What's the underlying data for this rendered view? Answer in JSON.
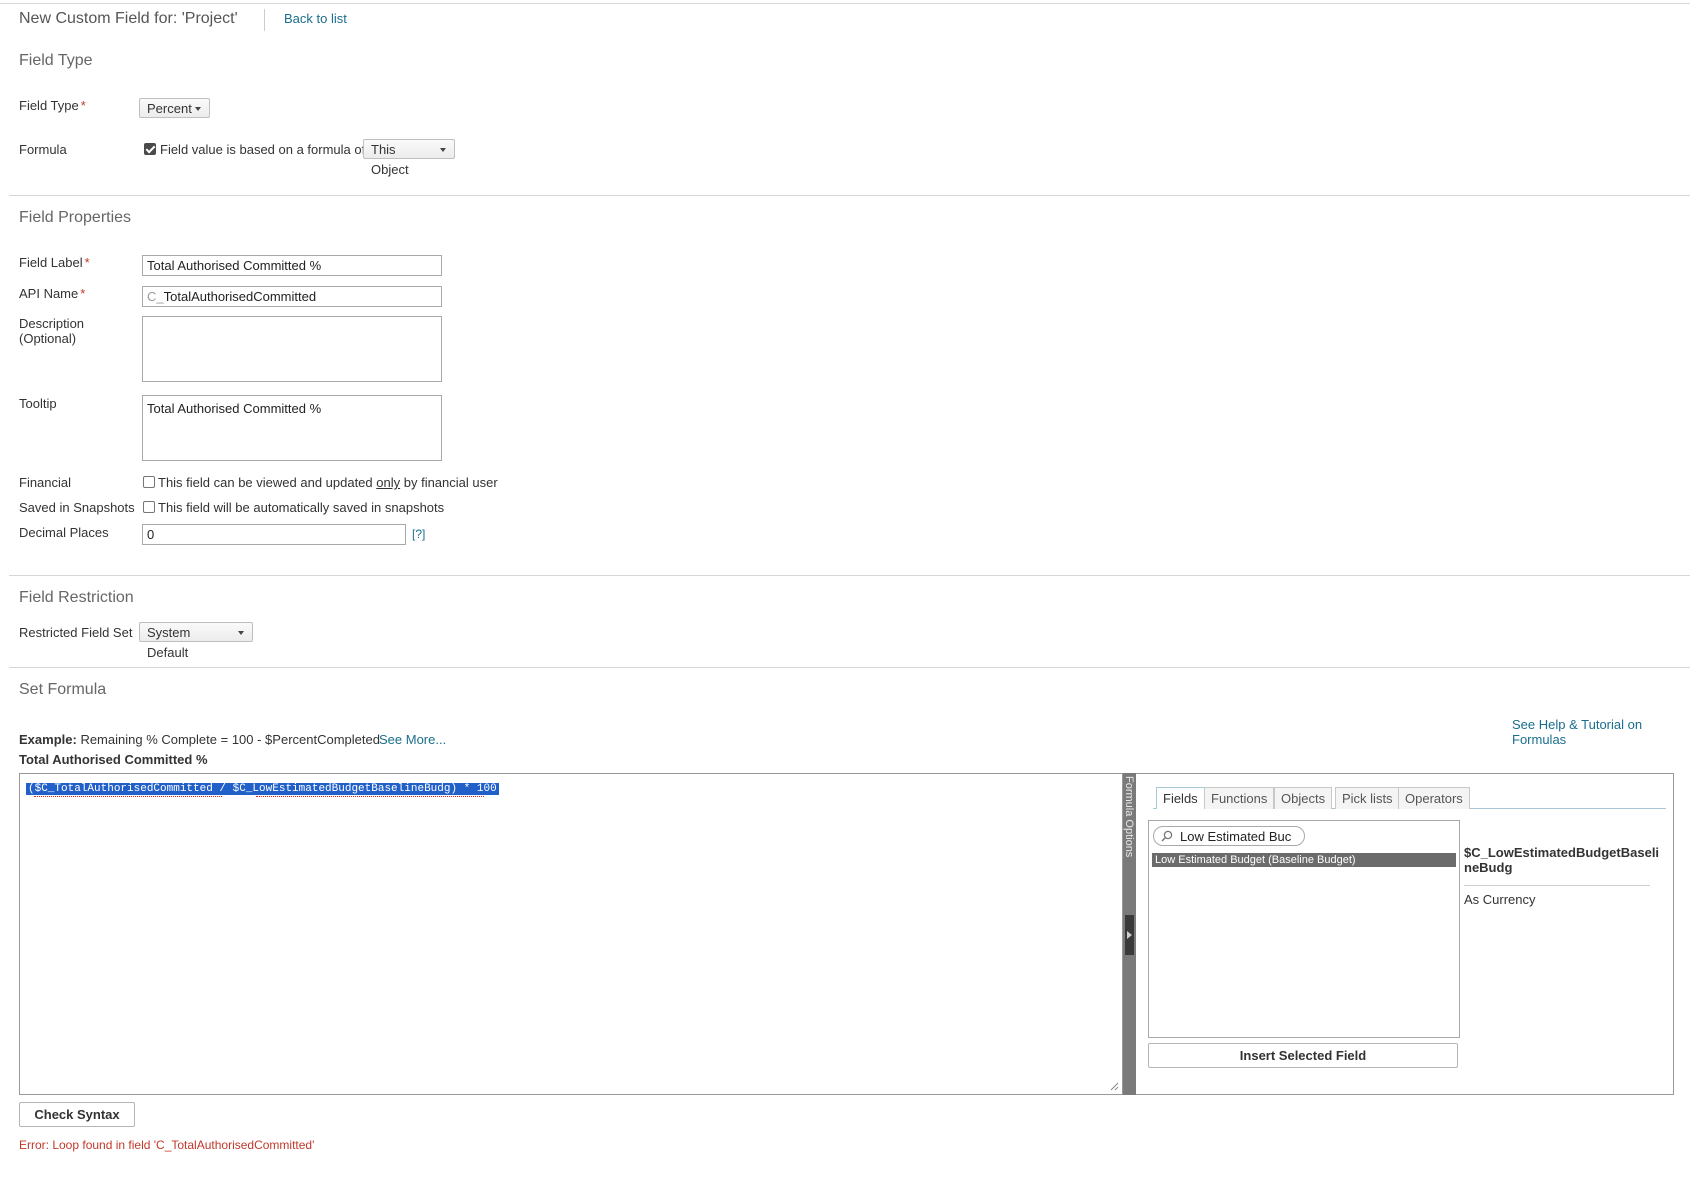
{
  "header": {
    "title": "New Custom Field for: 'Project'",
    "back_link": "Back to list"
  },
  "field_type_section": {
    "title": "Field Type",
    "field_type_label": "Field Type",
    "field_type_value": "Percent",
    "formula_label": "Formula",
    "formula_checkbox_label": "Field value is based on a formula of:",
    "formula_checked": true,
    "formula_object_value": "This Object"
  },
  "properties_section": {
    "title": "Field Properties",
    "field_label_label": "Field Label",
    "field_label_value": "Total Authorised Committed %",
    "api_name_label": "API Name",
    "api_name_prefix": "C_",
    "api_name_value": "TotalAuthorisedCommitted",
    "description_label_1": "Description",
    "description_label_2": "(Optional)",
    "description_value": "",
    "tooltip_label": "Tooltip",
    "tooltip_value": "Total Authorised Committed %",
    "financial_label": "Financial",
    "financial_text_before": "This field can be viewed and updated ",
    "financial_text_emph": "only",
    "financial_text_after": " by financial user",
    "snapshots_label": "Saved in Snapshots",
    "snapshots_text": "This field will be automatically saved in snapshots",
    "decimal_label": "Decimal Places",
    "decimal_value": "0",
    "decimal_help": "[?]"
  },
  "restriction_section": {
    "title": "Field Restriction",
    "restricted_label": "Restricted Field Set",
    "restricted_value": "System Default"
  },
  "formula_section": {
    "title": "Set Formula",
    "help_link": "See Help & Tutorial on Formulas",
    "example_prefix": "Example:",
    "example_text": "Remaining % Complete = 100 - $PercentCompleted",
    "see_more": "See More...",
    "field_name": "Total Authorised Committed %",
    "formula_text": "($C_TotalAuthorisedCommitted / $C_LowEstimatedBudgetBaselineBudg) * 100",
    "options_handle_label": "Formula Options",
    "tabs": [
      "Fields",
      "Functions",
      "Objects",
      "Pick lists",
      "Operators"
    ],
    "search_value": "Low Estimated Buc",
    "results": [
      "Low Estimated Budget (Baseline Budget)"
    ],
    "detail_api_line1": "$C_LowEstimatedBudgetBaseli",
    "detail_api_line2": "neBudg",
    "detail_type": "As Currency",
    "insert_button": "Insert Selected Field",
    "check_syntax_button": "Check Syntax",
    "error_text": "Error: Loop found in field 'C_TotalAuthorisedCommitted'"
  },
  "colors": {
    "link": "#1a6e8e",
    "error": "#c0392b",
    "selection": "#2160c9",
    "result_highlight": "#6b6b6b"
  }
}
